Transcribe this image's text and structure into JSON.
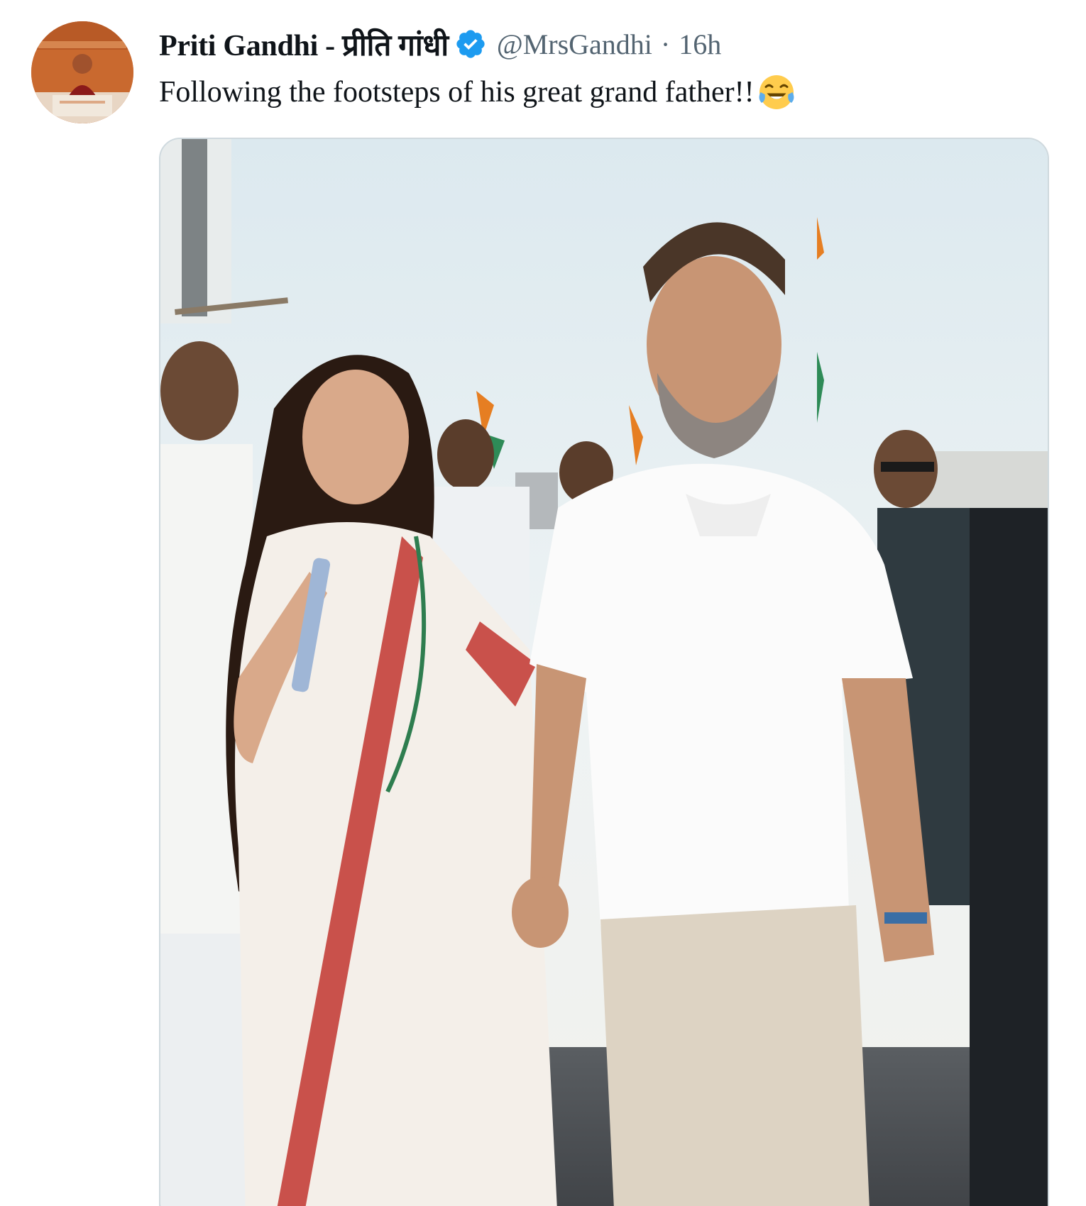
{
  "tweet": {
    "author": {
      "display_name": "Priti Gandhi - प्रीति गांधी",
      "handle": "@MrsGandhi",
      "verified": true,
      "avatar_icon": "profile-avatar"
    },
    "separator": "·",
    "timestamp": "16h",
    "text": "Following the footsteps of his great grand father!!",
    "emoji": "face-with-tears-of-joy-icon",
    "media": {
      "type": "photo",
      "icon": "tweet-photo"
    }
  },
  "colors": {
    "text_primary": "#0f1419",
    "text_secondary": "#536471",
    "verified_badge": "#1d9bf0",
    "media_border": "#cfd9de"
  }
}
